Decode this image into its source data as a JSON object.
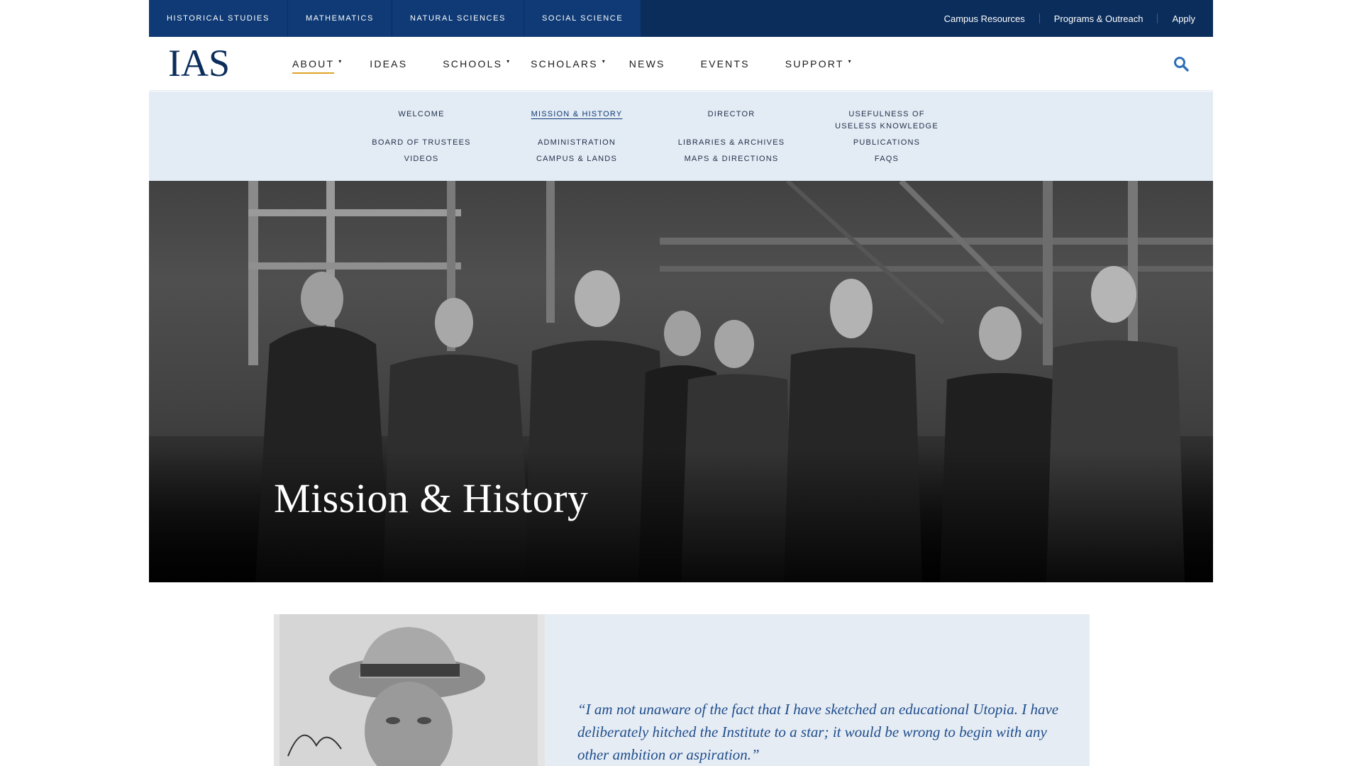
{
  "utility": {
    "schools": [
      "Historical Studies",
      "Mathematics",
      "Natural Sciences",
      "Social Science"
    ],
    "links": [
      "Campus Resources",
      "Programs & Outreach",
      "Apply"
    ]
  },
  "nav": {
    "logo": "IAS",
    "items": [
      {
        "label": "About",
        "caret": "▾"
      },
      {
        "label": "Ideas"
      },
      {
        "label": "Schools",
        "caret": "▾"
      },
      {
        "label": "Scholars",
        "caret": "▾"
      },
      {
        "label": "News"
      },
      {
        "label": "Events"
      },
      {
        "label": "Support",
        "caret": "▾"
      }
    ],
    "search_icon": "search-icon"
  },
  "dropdown": {
    "col1": [
      "Welcome",
      "Board of Trustees",
      "Videos"
    ],
    "col2": [
      "Mission & History",
      "Administration",
      "Campus & Lands"
    ],
    "col3": [
      "Director",
      "Libraries & Archives",
      "Maps & Directions"
    ],
    "col4": [
      "Usefulness of Useless Knowledge",
      "Publications",
      "FAQs"
    ]
  },
  "hero": {
    "title": "Mission & History"
  },
  "content": {
    "quote": "“I am not unaware of the fact that I have sketched an educational Utopia. I have deliberately hitched the Institute to a star; it would be wrong to begin with any other ambition or aspiration.”"
  },
  "colors": {
    "navy": "#0b2d5c",
    "school_bar": "#0f3a75",
    "accent": "#e0a526",
    "dropdown_bg": "#e3ebf4",
    "quote_text": "#1f4e8c"
  }
}
